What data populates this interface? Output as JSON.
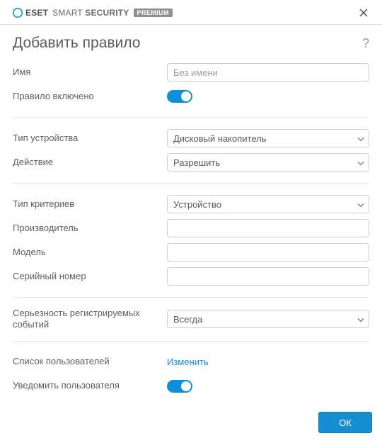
{
  "titlebar": {
    "brand_bold": "eset",
    "brand_rest_light": "SMART ",
    "brand_rest_bold": "SECURITY",
    "badge": "PREMIUM"
  },
  "heading": "Добавить правило",
  "fields": {
    "name_label": "Имя",
    "name_placeholder": "Без имени",
    "enabled_label": "Правило включено",
    "device_type_label": "Тип устройства",
    "device_type_value": "Дисковый накопитель",
    "action_label": "Действие",
    "action_value": "Разрешить",
    "criteria_type_label": "Тип критериев",
    "criteria_type_value": "Устройство",
    "vendor_label": "Производитель",
    "model_label": "Модель",
    "serial_label": "Серийный номер",
    "severity_label": "Серьезность регистрируемых событий",
    "severity_value": "Всегда",
    "user_list_label": "Список пользователей",
    "user_list_action": "Изменить",
    "notify_user_label": "Уведомить пользователя"
  },
  "footer": {
    "ok": "ОК"
  }
}
